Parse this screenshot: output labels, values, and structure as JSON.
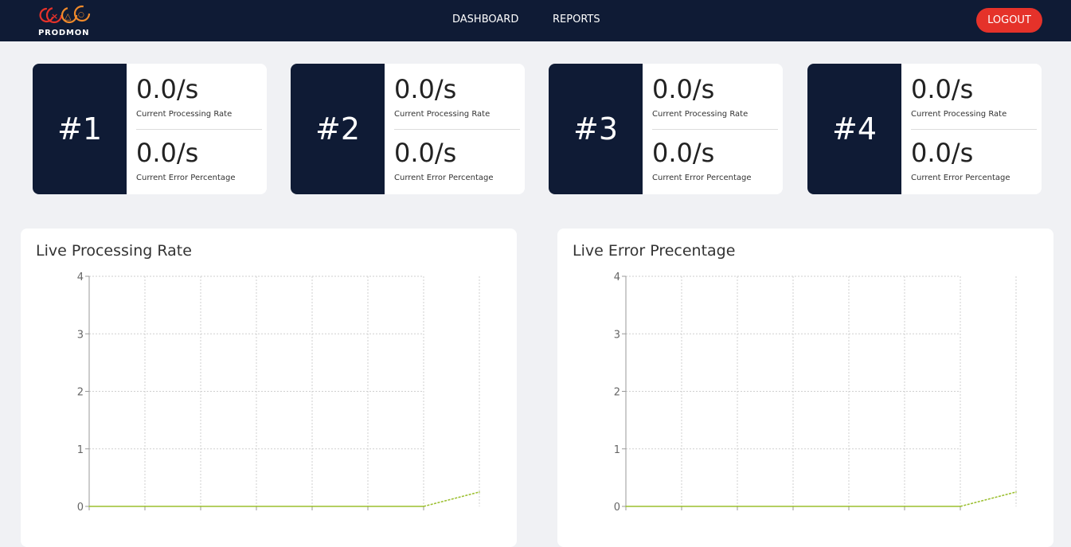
{
  "app": {
    "name": "PRODMON",
    "brand_color": "#e5322a",
    "nav_bg": "#0f1b35",
    "logo_glyphs": [
      "×",
      "△",
      "○"
    ]
  },
  "nav": {
    "links": [
      "DASHBOARD",
      "REPORTS"
    ],
    "logout_label": "LOGOUT"
  },
  "machines": [
    {
      "id": "#1",
      "rate": "0.0/s",
      "rate_label": "Current Processing Rate",
      "error": "0.0/s",
      "error_label": "Current Error Percentage"
    },
    {
      "id": "#2",
      "rate": "0.0/s",
      "rate_label": "Current Processing Rate",
      "error": "0.0/s",
      "error_label": "Current Error Percentage"
    },
    {
      "id": "#3",
      "rate": "0.0/s",
      "rate_label": "Current Processing Rate",
      "error": "0.0/s",
      "error_label": "Current Error Percentage"
    },
    {
      "id": "#4",
      "rate": "0.0/s",
      "rate_label": "Current Processing Rate",
      "error": "0.0/s",
      "error_label": "Current Error Percentage"
    }
  ],
  "chart_data": [
    {
      "type": "line",
      "title": "Live Processing Rate",
      "x": [
        0,
        1,
        2,
        3,
        4,
        5,
        6,
        7
      ],
      "series": [
        {
          "values": [
            0,
            0,
            0,
            0,
            0,
            0,
            0,
            0.25
          ],
          "color": "#9bbf2f"
        }
      ],
      "ylim": [
        0,
        4
      ],
      "yticks": [
        "0",
        "1",
        "2",
        "3",
        "4"
      ],
      "grid": true
    },
    {
      "type": "line",
      "title": "Live Error Precentage",
      "x": [
        0,
        1,
        2,
        3,
        4,
        5,
        6,
        7
      ],
      "series": [
        {
          "values": [
            0,
            0,
            0,
            0,
            0,
            0,
            0,
            0.25
          ],
          "color": "#9bbf2f"
        }
      ],
      "ylim": [
        0,
        4
      ],
      "yticks": [
        "0",
        "1",
        "2",
        "3",
        "4"
      ],
      "grid": true
    }
  ]
}
